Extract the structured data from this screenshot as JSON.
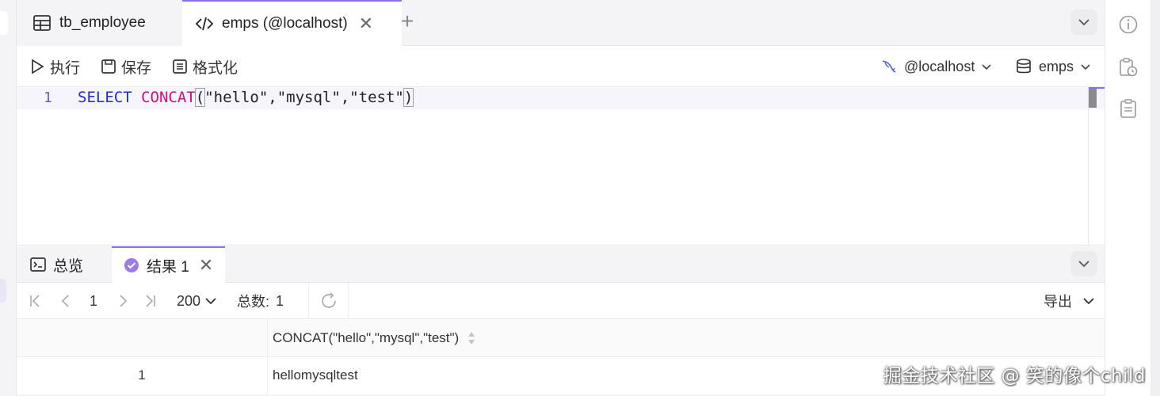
{
  "tabs": [
    {
      "label": "tb_employee",
      "icon": "table-icon"
    },
    {
      "label": "emps (@localhost)",
      "icon": "code-icon",
      "close": "✕"
    }
  ],
  "new_tab": "+",
  "toolbar": {
    "run_label": "执行",
    "save_label": "保存",
    "format_label": "格式化",
    "connection_label": "@localhost",
    "database_label": "emps"
  },
  "editor": {
    "line_number": "1",
    "tokens": {
      "select": "SELECT",
      "fn": "CONCAT",
      "open": "(",
      "args": "\"hello\",\"mysql\",\"test\"",
      "close": ")"
    }
  },
  "result_tabs": [
    {
      "label": "总览",
      "icon": "terminal-icon"
    },
    {
      "label": "结果 1",
      "icon": "check-circle-icon",
      "close": "✕"
    }
  ],
  "pager": {
    "page": "1",
    "page_size": "200",
    "total_label": "总数:",
    "total_value": "1",
    "export_label": "导出"
  },
  "table": {
    "columns": [
      "CONCAT(\"hello\",\"mysql\",\"test\")"
    ],
    "rows": [
      {
        "index": "1",
        "cells": [
          "hellomysqltest"
        ]
      }
    ]
  },
  "watermark": "掘金技术社区 @ 笑的像个child",
  "colors": {
    "accent": "#8b6ee8",
    "keyword_blue": "#1d2fc9",
    "keyword_pink": "#c8147d"
  }
}
